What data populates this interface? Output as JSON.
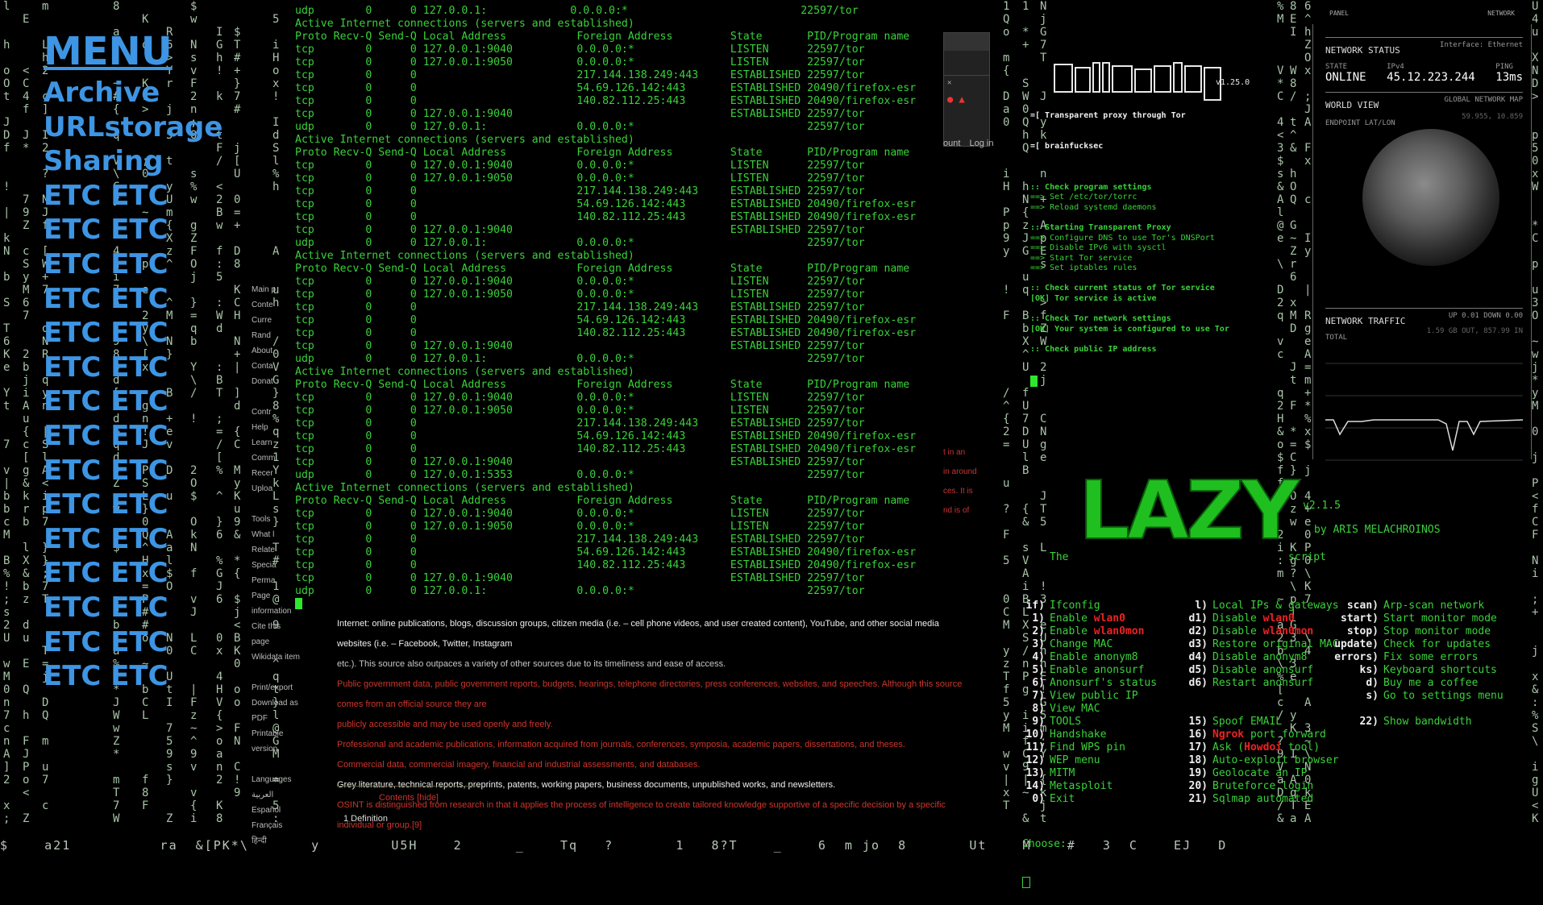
{
  "menu": {
    "title": "MENU",
    "items": [
      "Archive",
      "URLstorage",
      "Sharing"
    ],
    "etc_label": "ETC"
  },
  "netstat": {
    "top_line": "udp        0      0 127.0.0.1:             0.0.0.0:*                           22597/tor",
    "blocks": [
      {
        "title": "Active Internet connections (servers and established)",
        "header": "Proto Recv-Q Send-Q Local Address           Foreign Address         State       PID/Program name",
        "rows": [
          "tcp        0      0 127.0.0.1:9040          0.0.0.0:*               LISTEN      22597/tor",
          "tcp        0      0 127.0.0.1:9050          0.0.0.0:*               LISTEN      22597/tor",
          "tcp        0      0                         217.144.138.249:443     ESTABLISHED 22597/tor",
          "tcp        0      0                         54.69.126.142:443       ESTABLISHED 20490/firefox-esr",
          "tcp        0      0                         140.82.112.25:443       ESTABLISHED 20490/firefox-esr",
          "tcp        0      0 127.0.0.1:9040                                  ESTABLISHED 22597/tor",
          "udp        0      0 127.0.0.1:              0.0.0.0:*                           22597/tor"
        ]
      },
      {
        "title": "Active Internet connections (servers and established)",
        "header": "Proto Recv-Q Send-Q Local Address           Foreign Address         State       PID/Program name",
        "rows": [
          "tcp        0      0 127.0.0.1:9040          0.0.0.0:*               LISTEN      22597/tor",
          "tcp        0      0 127.0.0.1:9050          0.0.0.0:*               LISTEN      22597/tor",
          "tcp        0      0                         217.144.138.249:443     ESTABLISHED 22597/tor",
          "tcp        0      0                         54.69.126.142:443       ESTABLISHED 20490/firefox-esr",
          "tcp        0      0                         140.82.112.25:443       ESTABLISHED 20490/firefox-esr",
          "tcp        0      0 127.0.0.1:9040                                  ESTABLISHED 22597/tor",
          "udp        0      0 127.0.0.1:              0.0.0.0:*                           22597/tor"
        ]
      },
      {
        "title": "Active Internet connections (servers and established)",
        "header": "Proto Recv-Q Send-Q Local Address           Foreign Address         State       PID/Program name",
        "rows": [
          "tcp        0      0 127.0.0.1:9040          0.0.0.0:*               LISTEN      22597/tor",
          "tcp        0      0 127.0.0.1:9050          0.0.0.0:*               LISTEN      22597/tor",
          "tcp        0      0                         217.144.138.249:443     ESTABLISHED 22597/tor",
          "tcp        0      0                         54.69.126.142:443       ESTABLISHED 20490/firefox-esr",
          "tcp        0      0                         140.82.112.25:443       ESTABLISHED 20490/firefox-esr",
          "tcp        0      0 127.0.0.1:9040                                  ESTABLISHED 22597/tor",
          "udp        0      0 127.0.0.1:              0.0.0.0:*                           22597/tor"
        ]
      },
      {
        "title": "Active Internet connections (servers and established)",
        "header": "Proto Recv-Q Send-Q Local Address           Foreign Address         State       PID/Program name",
        "rows": [
          "tcp        0      0 127.0.0.1:9040          0.0.0.0:*               LISTEN      22597/tor",
          "tcp        0      0 127.0.0.1:9050          0.0.0.0:*               LISTEN      22597/tor",
          "tcp        0      0                         217.144.138.249:443     ESTABLISHED 22597/tor",
          "tcp        0      0                         54.69.126.142:443       ESTABLISHED 20490/firefox-esr",
          "tcp        0      0                         140.82.112.25:443       ESTABLISHED 20490/firefox-esr",
          "tcp        0      0 127.0.0.1:9040                                  ESTABLISHED 22597/tor",
          "udp        0      0 127.0.0.1:5353          0.0.0.0:*                           22597/tor"
        ]
      },
      {
        "title": "Active Internet connections (servers and established)",
        "header": "Proto Recv-Q Send-Q Local Address           Foreign Address         State       PID/Program name",
        "rows": [
          "tcp        0      0 127.0.0.1:9040          0.0.0.0:*               LISTEN      22597/tor",
          "tcp        0      0 127.0.0.1:9050          0.0.0.0:*               LISTEN      22597/tor",
          "tcp        0      0                         217.144.138.249:443     ESTABLISHED 22597/tor",
          "tcp        0      0                         54.69.126.142:443       ESTABLISHED 20490/firefox-esr",
          "tcp        0      0                         140.82.112.25:443       ESTABLISHED 20490/firefox-esr",
          "tcp        0      0 127.0.0.1:9040                                  ESTABLISHED 22597/tor",
          "udp        0      0 127.0.0.1:              0.0.0.0:*                           22597/tor"
        ]
      }
    ]
  },
  "wiki": {
    "lines": [
      "Internet: online publications, blogs, discussion groups, citizen media (i.e. – cell phone videos, and user created content), YouTube, and other social media websites (i.e. – Facebook, Twitter, Instagram",
      "etc.). This source also outpaces a variety of other sources due to its timeliness and ease of access.",
      "Public government data, public government reports, budgets, hearings, telephone directories, press conferences, websites, and speeches. Although this source comes from an official source they are",
      "publicly accessible and may be used openly and freely.",
      "Professional and academic publications, information acquired from journals, conferences, symposia, academic papers, dissertations, and theses.",
      "Commercial data, commercial imagery, financial and industrial assessments, and databases.",
      "Grey literature, technical reports, preprints, patents, working papers, business documents, unpublished works, and newsletters.",
      "OSINT is distinguished from research in that it applies the process of intelligence to create tailored knowledge supportive of a specific decision by a specific individual or group.[9]"
    ],
    "toc_title": "Contents [hide]",
    "toc_item": "1 Definition",
    "side_links": [
      "Main p",
      "Conte",
      "Curre",
      "Rand",
      "About",
      "Conta",
      "Donat",
      "",
      "Contr",
      "Help",
      "Learn",
      "Comm",
      "Recer",
      "Uploa",
      "",
      "Tools",
      "What l",
      "Relate",
      "Specia",
      "Perma",
      "Page information",
      "Cite this page",
      "Wikidata item",
      "",
      "Print/export",
      "Download as PDF",
      "Printable version",
      "",
      "Languages",
      "العربية",
      "Español",
      "Français",
      "हिन्दी"
    ]
  },
  "browser": {
    "links": [
      "ount",
      "Log in"
    ],
    "notes": [
      "t in an",
      "in around",
      "ces. It is",
      "",
      "nd is of"
    ]
  },
  "torify": {
    "version": "v1.25.0",
    "tagline1": "=[ Transparent proxy through Tor",
    "tagline2": "=[ brainfucksec",
    "sections": [
      {
        "head": ":: Check program settings",
        "items": [
          "==> Set /etc/tor/torrc",
          "==> Reload systemd daemons"
        ]
      },
      {
        "head": ":: Starting Transparent Proxy",
        "items": [
          "==> Configure DNS to use Tor's DNSPort",
          "==> Disable IPv6 with sysctl",
          "==> Start Tor service",
          "==> Set iptables rules"
        ]
      },
      {
        "head": ":: Check current status of Tor service",
        "items": [
          "[OK] Tor service is active"
        ]
      },
      {
        "head": ":: Check Tor network settings",
        "items": [
          "[OK] Your system is configured to use Tor"
        ]
      },
      {
        "head": ":: Check public IP address",
        "items": []
      }
    ]
  },
  "panel": {
    "top_left": "PANEL",
    "top_right": "NETWORK",
    "status_title": "NETWORK STATUS",
    "interface": "Interface: Ethernet",
    "state_label": "STATE",
    "state_value": "ONLINE",
    "ip_label": "IPv4",
    "ip_value": "45.12.223.244",
    "ping_label": "PING",
    "ping_value": "13ms",
    "world_title": "WORLD VIEW",
    "world_sub": "GLOBAL NETWORK MAP",
    "endpoint_label": "ENDPOINT LAT/LON",
    "endpoint_value": "59.955, 10.859",
    "traffic_title": "NETWORK TRAFFIC",
    "traffic_updown": "UP 0.01 DOWN 0.00",
    "traffic_total": "TOTAL",
    "traffic_total_value": "1.59 GB OUT, 857.99 IN"
  },
  "lazy": {
    "logo": "LAZY",
    "version": "v2.1.5",
    "by": "by ARIS MELACHROINOS",
    "the": "The",
    "script": "script",
    "col1": [
      [
        "if)",
        "Ifconfig"
      ],
      [
        "1)",
        "Enable wlan0"
      ],
      [
        "2)",
        "Enable wlan0mon"
      ],
      [
        "3)",
        "Change MAC"
      ],
      [
        "4)",
        "Enable anonym8"
      ],
      [
        "5)",
        "Enable anonsurf"
      ],
      [
        "6)",
        "Anonsurf's status"
      ],
      [
        "7)",
        "View public IP"
      ],
      [
        "8)",
        "View MAC"
      ],
      [
        "9)",
        "TOOLS"
      ],
      [
        "10)",
        "Handshake"
      ],
      [
        "11)",
        "Find WPS pin"
      ],
      [
        "12)",
        "WEP menu"
      ],
      [
        "13)",
        "MITM"
      ],
      [
        "14)",
        "Metasploit"
      ],
      [
        "0)",
        "Exit"
      ]
    ],
    "col2": [
      [
        "l)",
        "Local IPs & gateways"
      ],
      [
        "d1)",
        "Disable wlan0"
      ],
      [
        "d2)",
        "Disable wlan0mon"
      ],
      [
        "d3)",
        "Restore original MAC"
      ],
      [
        "d4)",
        "Disable anonym8"
      ],
      [
        "d5)",
        "Disable anonsurf"
      ],
      [
        "d6)",
        "Restart anonsurf"
      ],
      [
        "",
        ""
      ],
      [
        "",
        ""
      ],
      [
        "15)",
        "Spoof EMAIL"
      ],
      [
        "16)",
        "Ngrok port forward"
      ],
      [
        "17)",
        "Ask (Howdoi tool)"
      ],
      [
        "18)",
        "Auto-exploit browser"
      ],
      [
        "19)",
        "Geolocate an IP"
      ],
      [
        "20)",
        "Bruteforce login"
      ],
      [
        "21)",
        "Sqlmap automated"
      ]
    ],
    "col3": [
      [
        "scan)",
        "Arp-scan network"
      ],
      [
        "start)",
        "Start monitor mode"
      ],
      [
        "stop)",
        "Stop monitor mode"
      ],
      [
        "update)",
        "Check for updates"
      ],
      [
        "errors)",
        "Fix some errors"
      ],
      [
        "ks)",
        "Keyboard shortcuts"
      ],
      [
        "d)",
        "Buy me a coffee"
      ],
      [
        "s)",
        "Go to settings menu"
      ],
      [
        "",
        ""
      ],
      [
        "22)",
        "Show bandwidth"
      ]
    ],
    "prompt": "Choose:"
  },
  "bottom_glyphs": "$    a21          ra  &[PK*\\       y        U5H    2      _    Tq   ?       1   8?T    _    6  m jo  8       Ut    M    #   3  C    EJ   D",
  "colors": {
    "accent_blue": "#3d95e4",
    "term_green": "#3ad13a",
    "alert_red": "#e22222"
  }
}
